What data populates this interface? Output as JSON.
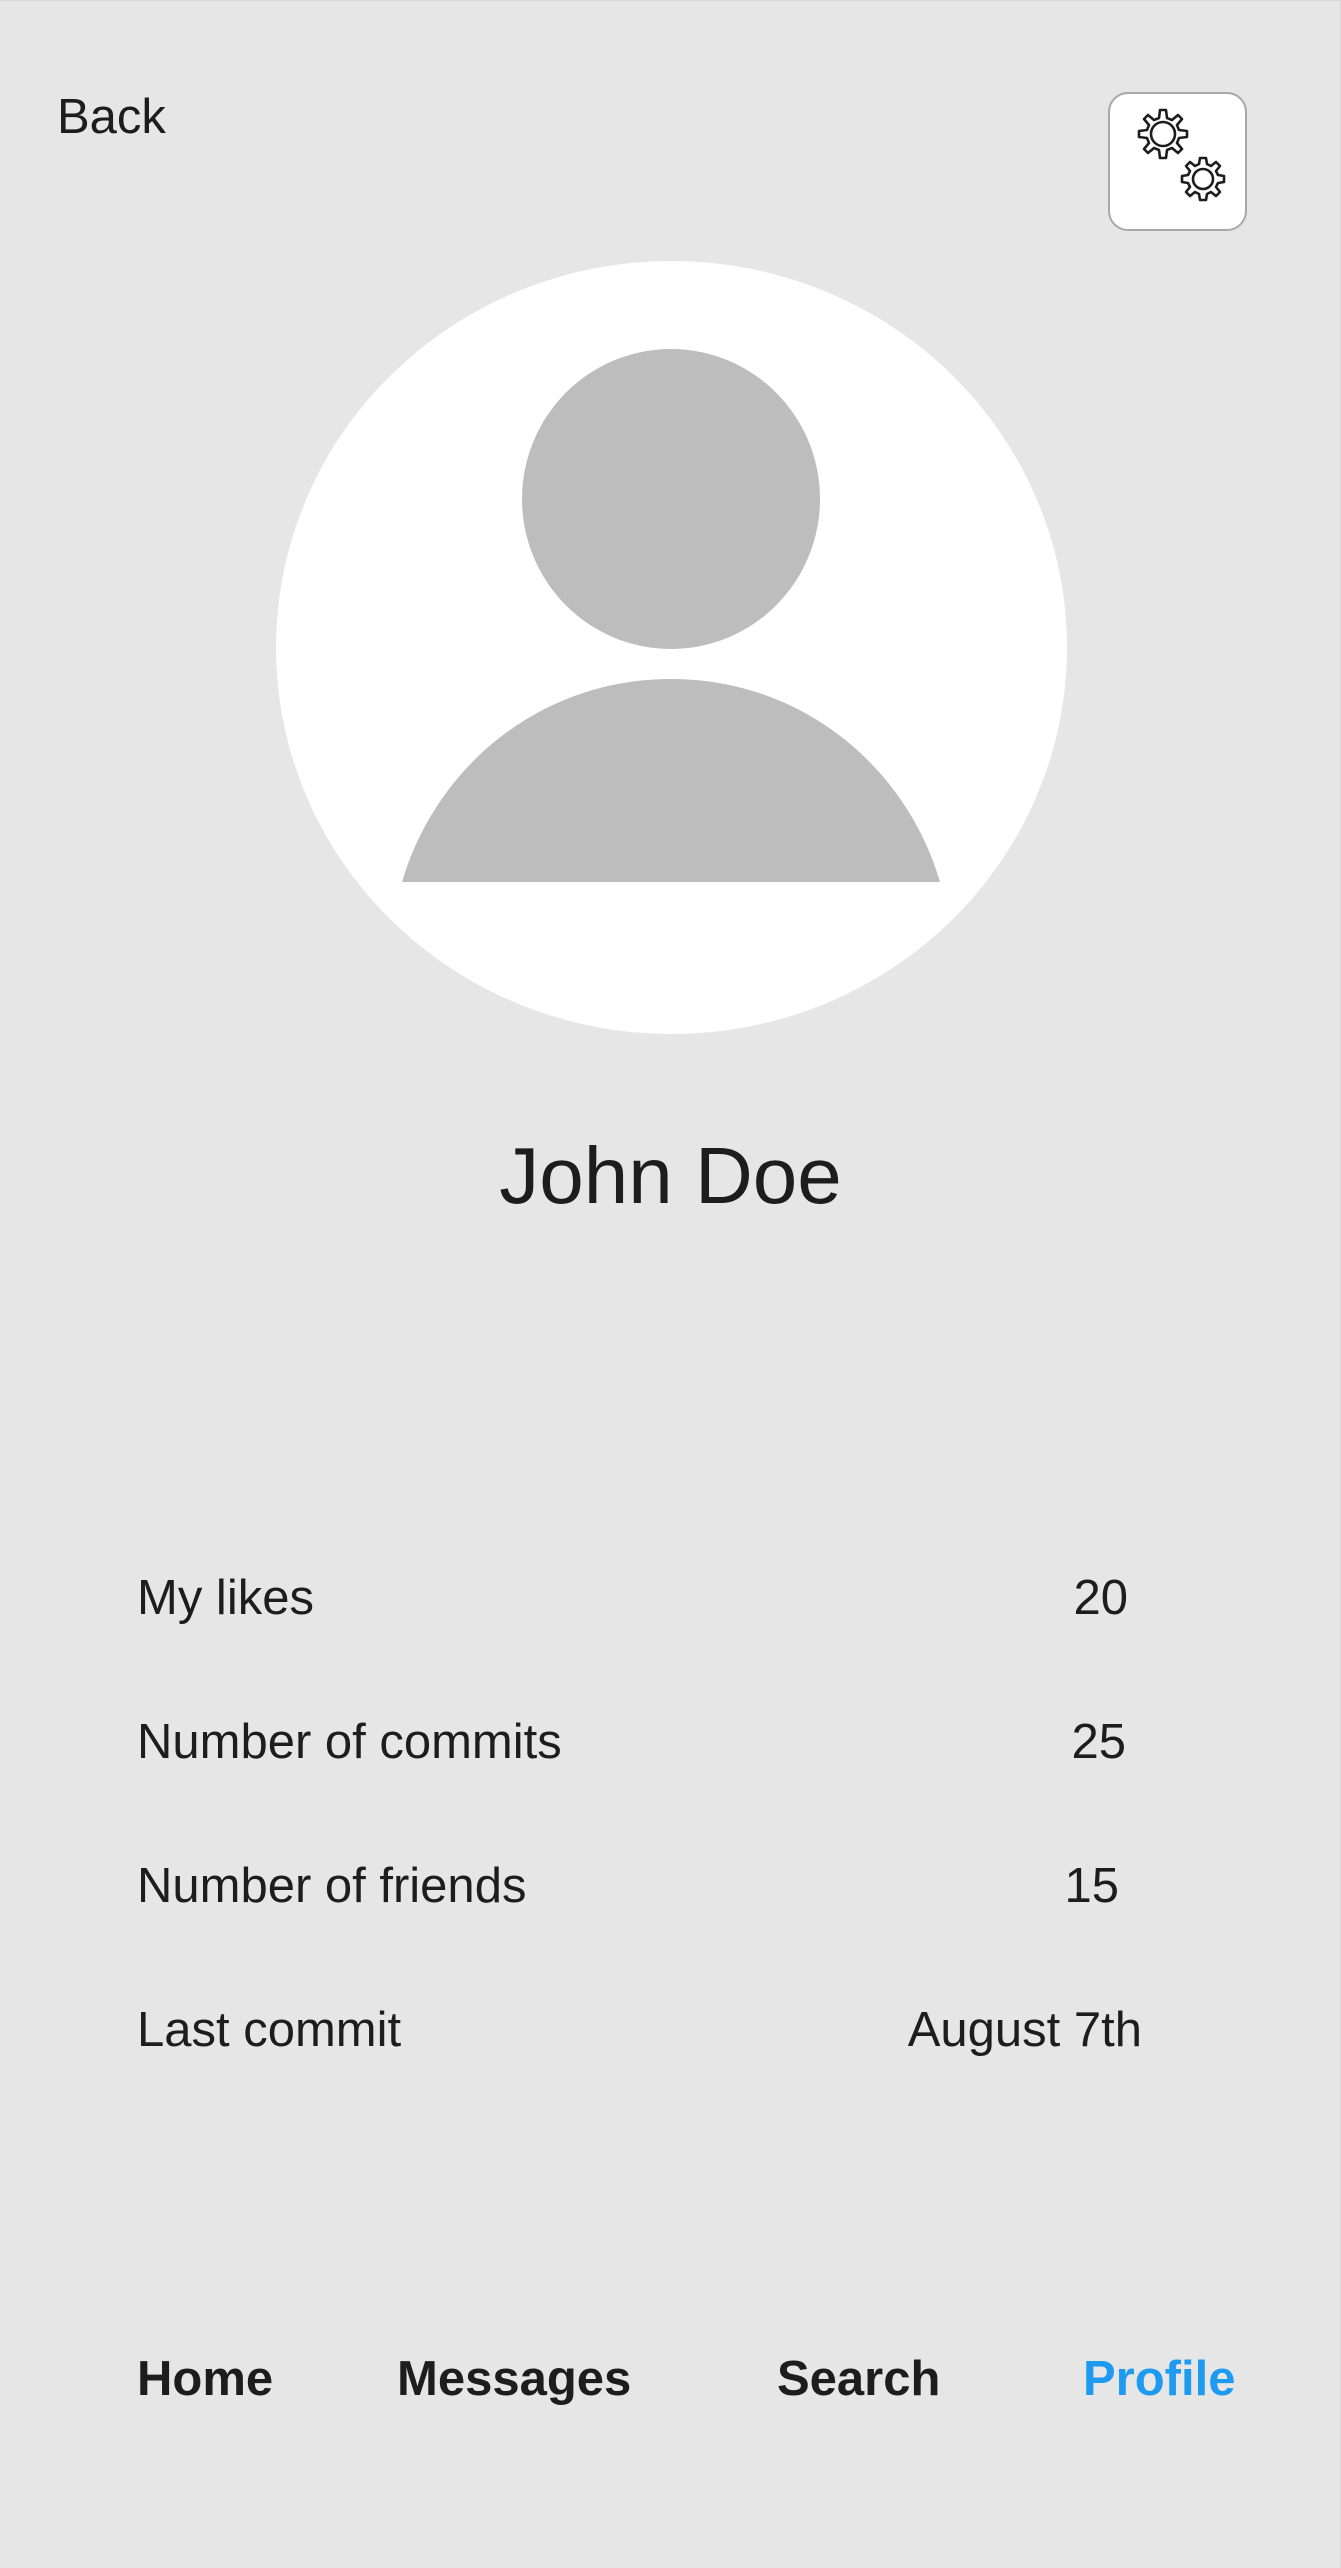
{
  "header": {
    "back_label": "Back",
    "settings_icon": "gears-icon"
  },
  "profile": {
    "avatar_icon": "user-placeholder-icon",
    "name": "John Doe"
  },
  "stats": [
    {
      "label": "My likes",
      "value": "20"
    },
    {
      "label": "Number of commits",
      "value": "25"
    },
    {
      "label": "Number of friends",
      "value": "15"
    },
    {
      "label": "Last commit",
      "value": "August 7th"
    }
  ],
  "nav": {
    "items": [
      {
        "label": "Home",
        "active": false
      },
      {
        "label": "Messages",
        "active": false
      },
      {
        "label": "Search",
        "active": false
      },
      {
        "label": "Profile",
        "active": true
      }
    ]
  },
  "colors": {
    "background": "#e6e6e6",
    "active_nav": "#1e9bf0",
    "avatar_bg": "#ffffff",
    "avatar_silhouette": "#bdbdbd",
    "text": "#1d1d1d"
  }
}
